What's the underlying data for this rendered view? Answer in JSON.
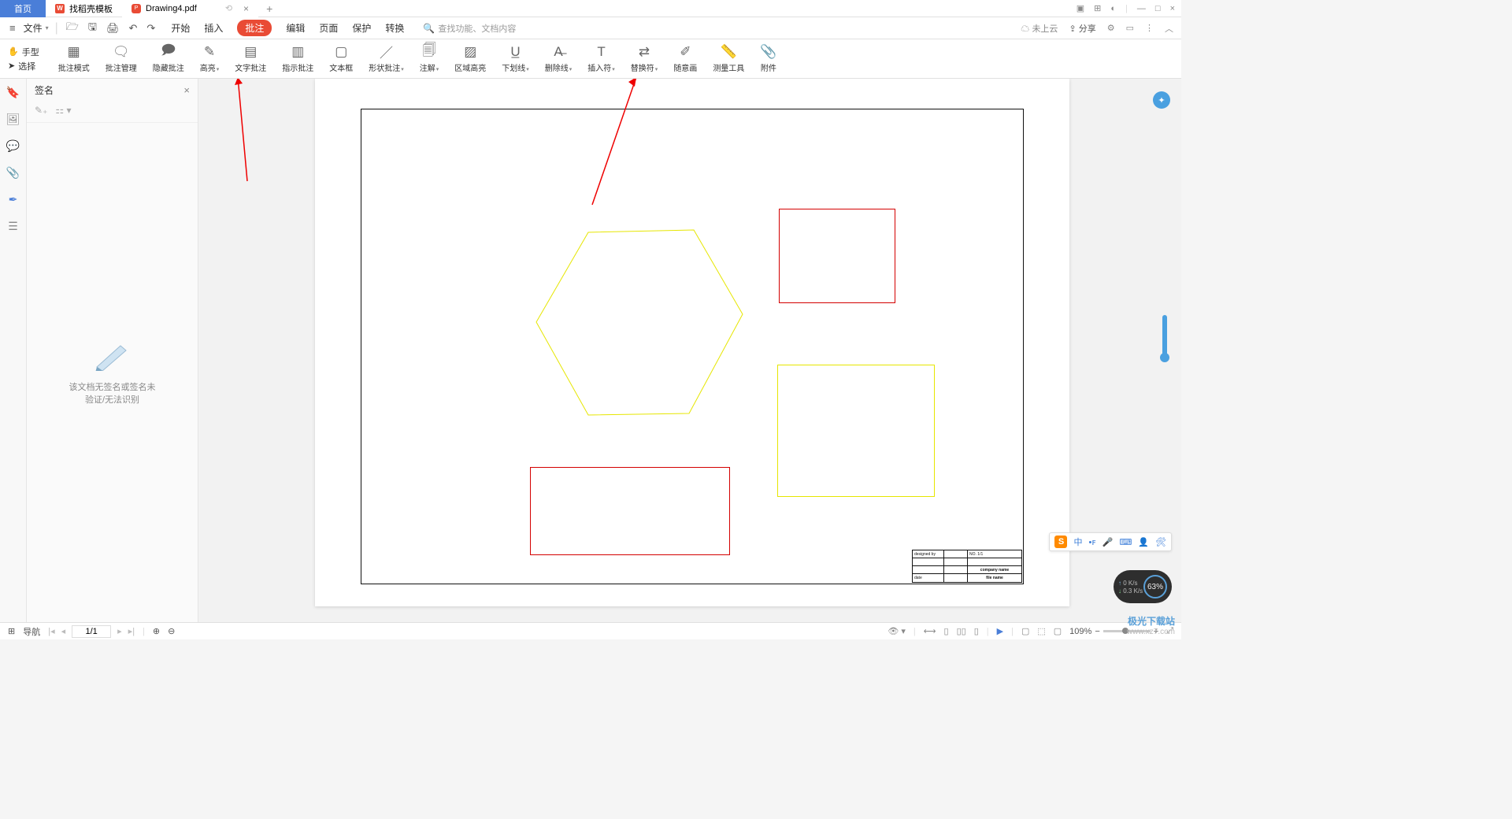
{
  "tabs": {
    "home": "首页",
    "template": "找稻壳模板",
    "doc": "Drawing4.pdf"
  },
  "menu": {
    "file": "文件",
    "items": [
      "开始",
      "插入",
      "批注",
      "编辑",
      "页面",
      "保护",
      "转换"
    ],
    "search_placeholder": "查找功能、文档内容",
    "cloud": "未上云",
    "share": "分享"
  },
  "mode": {
    "hand": "手型",
    "select": "选择"
  },
  "tools": [
    {
      "label": "批注模式"
    },
    {
      "label": "批注管理"
    },
    {
      "label": "隐藏批注"
    },
    {
      "label": "高亮",
      "dd": true
    },
    {
      "label": "文字批注"
    },
    {
      "label": "指示批注"
    },
    {
      "label": "文本框"
    },
    {
      "label": "形状批注",
      "dd": true
    },
    {
      "label": "注解",
      "dd": true
    },
    {
      "label": "区域高亮"
    },
    {
      "label": "下划线",
      "dd": true
    },
    {
      "label": "删除线",
      "dd": true
    },
    {
      "label": "插入符",
      "dd": true
    },
    {
      "label": "替换符",
      "dd": true
    },
    {
      "label": "随意画"
    },
    {
      "label": "测量工具"
    },
    {
      "label": "附件"
    }
  ],
  "side_panel": {
    "title": "签名",
    "empty1": "该文档无签名或签名未",
    "empty2": "验证/无法识别"
  },
  "title_block": {
    "designed": "designed by",
    "data": "date",
    "company": "company name",
    "file": "file name",
    "no": "NO. 1/1"
  },
  "statusbar": {
    "nav_label": "导航",
    "page": "1/1",
    "zoom": "109%"
  },
  "net": {
    "up": "0 K/s",
    "down": "0.3 K/s",
    "pct": "63%"
  },
  "watermark": {
    "l1": "极光下载站",
    "l2": "www.xz7.com"
  },
  "ime_zh": "中"
}
